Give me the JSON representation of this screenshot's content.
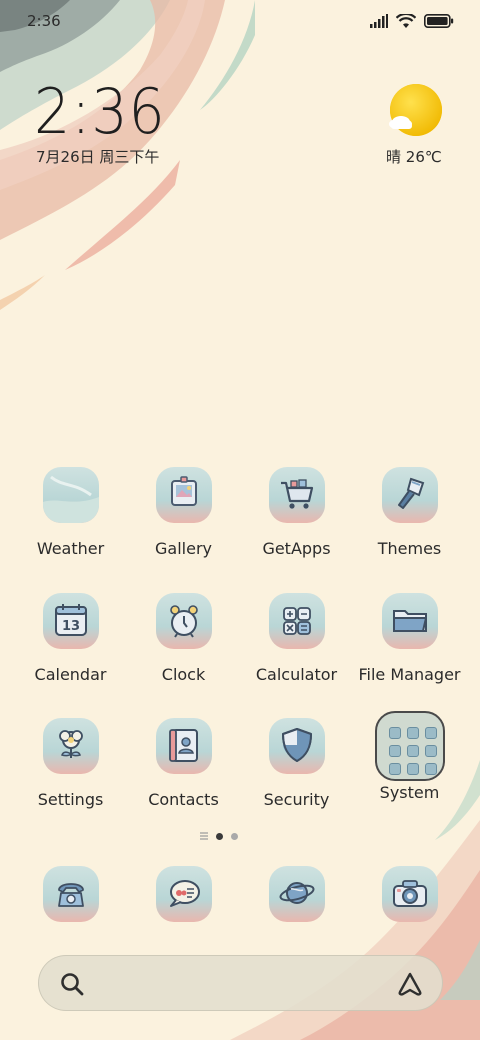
{
  "status_bar": {
    "time": "2:36",
    "icons": [
      "signal-icon",
      "wifi-icon",
      "battery-icon"
    ]
  },
  "clock_widget": {
    "time": "2:36",
    "date": "7月26日 周三下午"
  },
  "weather_widget": {
    "icon": "sun-cloud-icon",
    "condition": "晴",
    "temperature": "26℃"
  },
  "apps": [
    {
      "label": "Weather",
      "icon": "weather-icon"
    },
    {
      "label": "Gallery",
      "icon": "gallery-icon"
    },
    {
      "label": "GetApps",
      "icon": "shopping-cart-icon"
    },
    {
      "label": "Themes",
      "icon": "paintbrush-icon"
    },
    {
      "label": "Calendar",
      "icon": "calendar-icon",
      "day": "13"
    },
    {
      "label": "Clock",
      "icon": "alarm-clock-icon"
    },
    {
      "label": "Calculator",
      "icon": "calculator-icon"
    },
    {
      "label": "File Manager",
      "icon": "folder-icon"
    },
    {
      "label": "Settings",
      "icon": "flower-gear-icon"
    },
    {
      "label": "Contacts",
      "icon": "contacts-book-icon"
    },
    {
      "label": "Security",
      "icon": "shield-icon"
    },
    {
      "label": "System",
      "icon": "folder-grid-icon"
    }
  ],
  "page_indicator": {
    "pages": 2,
    "current": 1
  },
  "dock": [
    {
      "icon": "phone-icon"
    },
    {
      "icon": "message-bubble-icon"
    },
    {
      "icon": "planet-browser-icon"
    },
    {
      "icon": "camera-icon"
    }
  ],
  "search_bar": {
    "left_icon": "search-icon",
    "right_icon": "assistant-icon"
  },
  "colors": {
    "background": "#fbf2de",
    "icon_teal": "#b9d6d6",
    "icon_pink": "#e9b7ae",
    "text": "#2b2b2b"
  }
}
